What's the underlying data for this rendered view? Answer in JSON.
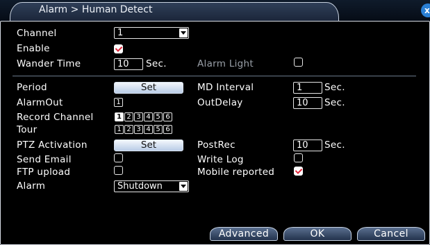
{
  "window": {
    "title": "Alarm > Human Detect",
    "close_label": "x"
  },
  "fields": {
    "channel": {
      "label": "Channel",
      "value": "1"
    },
    "enable": {
      "label": "Enable",
      "checked": true
    },
    "wander_time": {
      "label": "Wander Time",
      "value": "10",
      "unit": "Sec."
    },
    "alarm_light": {
      "label": "Alarm Light",
      "checked": false
    },
    "period": {
      "label": "Period",
      "button": "Set"
    },
    "md_interval": {
      "label": "MD Interval",
      "value": "1",
      "unit": "Sec."
    },
    "alarm_out": {
      "label": "AlarmOut",
      "boxes": [
        "1"
      ]
    },
    "out_delay": {
      "label": "OutDelay",
      "value": "10",
      "unit": "Sec."
    },
    "record_channel": {
      "label": "Record Channel",
      "boxes": [
        "1",
        "2",
        "3",
        "4",
        "5",
        "6"
      ],
      "selected": [
        "1"
      ]
    },
    "tour": {
      "label": "Tour",
      "boxes": [
        "1",
        "2",
        "3",
        "4",
        "5",
        "6"
      ],
      "selected": []
    },
    "ptz_activation": {
      "label": "PTZ Activation",
      "button": "Set"
    },
    "post_rec": {
      "label": "PostRec",
      "value": "10",
      "unit": "Sec."
    },
    "send_email": {
      "label": "Send Email",
      "checked": false
    },
    "write_log": {
      "label": "Write Log",
      "checked": false
    },
    "ftp_upload": {
      "label": "FTP upload",
      "checked": false
    },
    "mobile_reported": {
      "label": "Mobile reported",
      "checked": true
    },
    "alarm": {
      "label": "Alarm",
      "value": "Shutdown"
    }
  },
  "buttons": {
    "advanced": "Advanced",
    "ok": "OK",
    "cancel": "Cancel"
  },
  "colors": {
    "accent_check": "#e0263a",
    "close_button": "#2a7fd4",
    "button_gradient_top": "#f3f7fc"
  }
}
